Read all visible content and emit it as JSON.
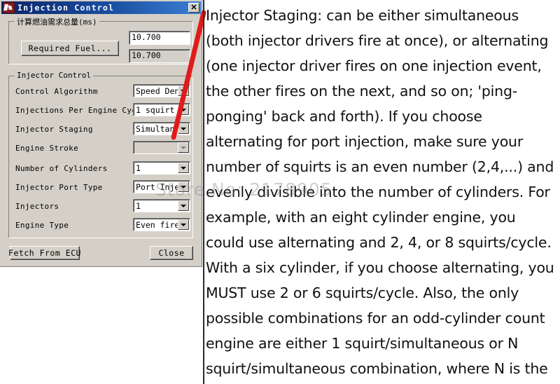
{
  "window": {
    "title": "Injection Control",
    "icon": "app-icon",
    "close_label": "✕"
  },
  "fuel_group": {
    "title": "计算燃油需求总量(ms)",
    "button_label": "Required Fuel...",
    "value_primary": "10.700",
    "value_secondary": "10.700"
  },
  "injector_group": {
    "title": "Injector Control",
    "rows": [
      {
        "label": "Control Algorithm",
        "value": "Speed Density",
        "disabled": false
      },
      {
        "label": "Injections Per Engine Cycle",
        "value": "1 squirt",
        "disabled": false
      },
      {
        "label": "Injector Staging",
        "value": "Simultaneous",
        "disabled": false
      },
      {
        "label": "Engine Stroke",
        "value": "",
        "disabled": true
      },
      {
        "label": "Number of Cylinders",
        "value": "1",
        "disabled": false
      },
      {
        "label": "Injector Port Type",
        "value": "Port Injection",
        "disabled": false
      },
      {
        "label": "Injectors",
        "value": "1",
        "disabled": false
      },
      {
        "label": "Engine Type",
        "value": "Even fire",
        "disabled": false
      }
    ]
  },
  "footer": {
    "fetch_label": "Fetch From ECU",
    "close_label": "Close"
  },
  "annotation": {
    "arrow_color": "#e01b1b",
    "points_at": "Injector Staging"
  },
  "watermark": {
    "text": "Store No: 2178905"
  },
  "explanation": {
    "body": "Injector Staging: can be either simultaneous (both injector drivers fire at once), or alternating (one injector driver fires on one injection event, the other fires on the next, and so on; 'ping-ponging' back and forth). If you choose alternating for port injection, make sure your number of squirts is an even number (2,4,...) and evenly divisible into the number of cylinders. For example, with an eight cylinder engine, you could use alternating and 2, 4, or 8 squirts/cycle. With a six cylinder, if you choose alternating, you MUST use 2 or 6 squirts/cycle. Also, the only possible combinations for an odd-cylinder count engine are either 1 squirt/simultaneous or N squirt/simultaneous combination, where N is the number of cylinders.\""
  }
}
